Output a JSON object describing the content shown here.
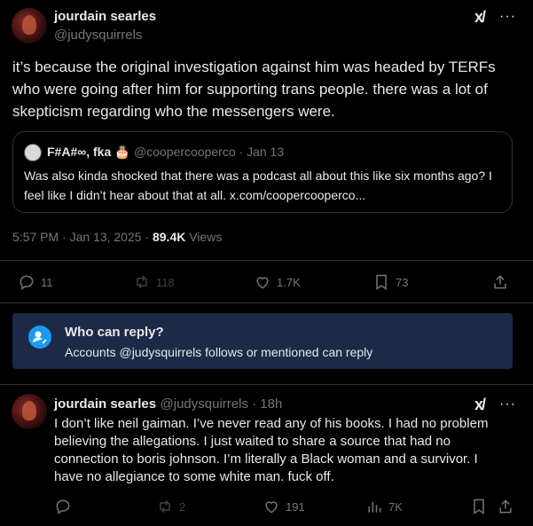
{
  "main_tweet": {
    "author_name": "jourdain searles",
    "author_handle": "@judysquirrels",
    "grok_label": "x/",
    "more_label": "···",
    "text": "it’s because the original investigation against him was headed by TERFs who were going after him for supporting trans people. there was a lot of skepticism regarding who the messengers were.",
    "quote": {
      "author_name": "F#A#∞, fka 🎂",
      "author_handle": "@coopercooperco · Jan 13",
      "text": "Was also kinda shocked that there was a podcast all about this like six months ago? I feel like I didn’t hear about that at all. x.com/coopercooperco..."
    },
    "timestamp": "5:57 PM · Jan 13, 2025 · ",
    "views_count": "89.4K",
    "views_label": " Views",
    "actions": {
      "replies": "11",
      "reposts": "118",
      "likes": "1.7K",
      "bookmarks": "73"
    }
  },
  "who_can_reply": {
    "title": "Who can reply?",
    "subtitle": "Accounts @judysquirrels follows or mentioned can reply"
  },
  "reply_tweet": {
    "author_name": "jourdain searles",
    "author_handle": "@judysquirrels · 18h",
    "grok_label": "x/",
    "more_label": "···",
    "lines": [
      "I don’t like neil gaiman. I’ve never read any of his books. I had no problem",
      "believing the allegations. I just waited to share a source that had no",
      "connection to boris johnson. I’m literally a Black woman and a survivor. I",
      "have no allegiance to some white man. fuck off."
    ],
    "actions": {
      "replies": "",
      "reposts": "2",
      "likes": "191",
      "views": "7K"
    }
  },
  "colors": {
    "background": "#000000",
    "text": "#e7e9ea",
    "muted": "#71767b",
    "accent": "#1d9bf0",
    "reply_box": "#1d2a47"
  }
}
